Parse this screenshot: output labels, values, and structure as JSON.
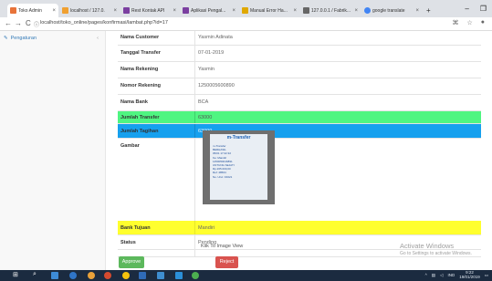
{
  "browser": {
    "tabs": [
      {
        "title": "Toko Admin",
        "color": "#e8733a"
      },
      {
        "title": "localhost / 127.0.",
        "color": "#f0a030"
      },
      {
        "title": "Rest Kontak API",
        "color": "#7b3fa0"
      },
      {
        "title": "Aplikasi Pengal...",
        "color": "#7b3fa0"
      },
      {
        "title": "Manual Error Ha...",
        "color": "#e0a800"
      },
      {
        "title": "127.0.0.1 / Fabrik...",
        "color": "#666666"
      },
      {
        "title": "google translate",
        "color": "#4285f4"
      }
    ],
    "new_tab": "+",
    "window_controls": {
      "minimize": "–",
      "maximize": "❐"
    },
    "url": "localhost/toko_online/pages/konfirmasi/lambat.php?id=17",
    "nav": {
      "back": "←",
      "forward": "→",
      "reload": "C"
    }
  },
  "sidebar": {
    "item_label": "Pengaturan",
    "chevron": "‹"
  },
  "detail": {
    "rows": [
      {
        "key": "Nama Customer",
        "value": "Yasmin Adinata"
      },
      {
        "key": "Tanggal Transfer",
        "value": "07-01-2019"
      },
      {
        "key": "Nama Rekening",
        "value": "Yasmin"
      },
      {
        "key": "Nomor Rekening",
        "value": "1250005600890"
      },
      {
        "key": "Nama Bank",
        "value": "BCA"
      },
      {
        "key": "Jumlah Transfer",
        "value": "63000",
        "highlight": "#4ff581"
      },
      {
        "key": "Jumlah Tagihan",
        "value": "63000",
        "highlight": "#16a0ee"
      },
      {
        "key": "Gambar",
        "value": ""
      },
      {
        "key": "Bank Tujuan",
        "value": "Mandiri",
        "highlight": "#ffff2e"
      },
      {
        "key": "Status",
        "value": "Pending"
      }
    ],
    "image_link": "Klik To Image View",
    "receipt": {
      "header": "m-Transfer",
      "lines": [
        "m-Transfer",
        "BERHASIL",
        "05/01 17:22:32",
        "Ke: Mandiri",
        "1450050016891",
        "UNTUNG SEJATI",
        "Rp.265.000,00",
        "Ref: 48564",
        "No. Urut: F4021"
      ]
    }
  },
  "actions": {
    "approve_label": "Approve",
    "reject_label": "Reject"
  },
  "watermark": {
    "line1": "Activate Windows",
    "line2": "Go to Settings to activate Windows."
  },
  "taskbar": {
    "time": "9:22",
    "date": "19/01/2019",
    "lang": "IND"
  }
}
